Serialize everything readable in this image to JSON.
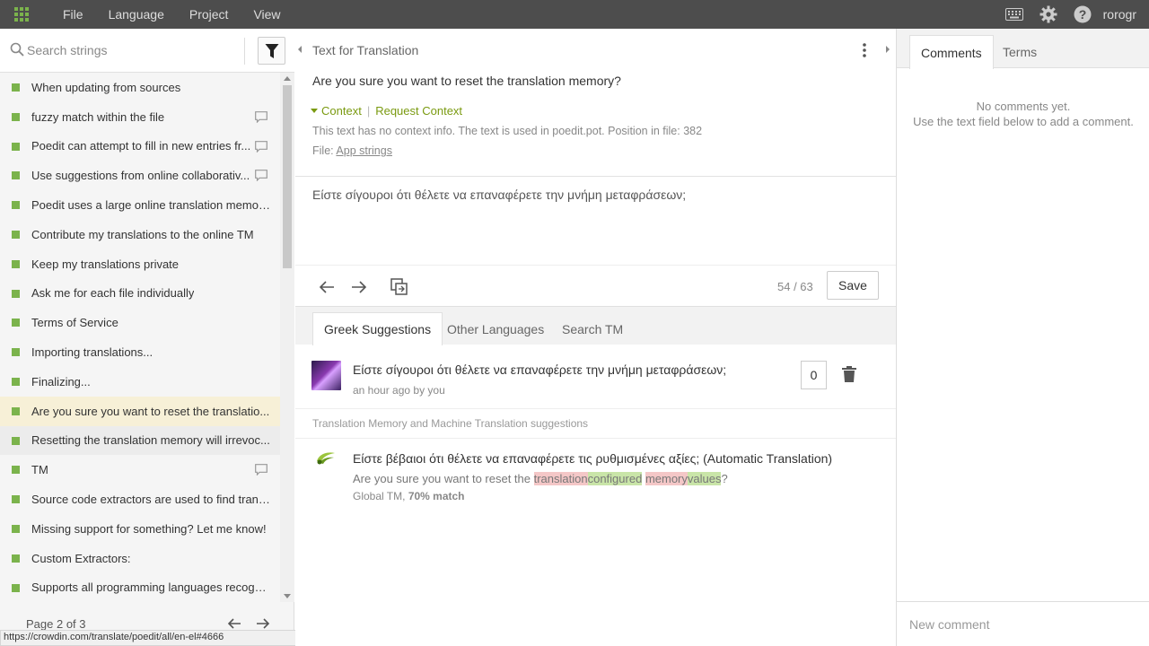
{
  "menu": {
    "items": [
      "File",
      "Language",
      "Project",
      "View"
    ]
  },
  "user": {
    "name": "rorogr"
  },
  "search": {
    "placeholder": "Search strings"
  },
  "strings": [
    {
      "text": "When updating from sources",
      "comment": false,
      "state": ""
    },
    {
      "text": "fuzzy match within the file",
      "comment": true,
      "state": ""
    },
    {
      "text": "Poedit can attempt to fill in new entries fr...",
      "comment": true,
      "state": ""
    },
    {
      "text": "Use suggestions from online collaborativ...",
      "comment": true,
      "state": ""
    },
    {
      "text": "Poedit uses a large online translation memor...",
      "comment": false,
      "state": ""
    },
    {
      "text": "Contribute my translations to the online TM",
      "comment": false,
      "state": ""
    },
    {
      "text": "Keep my translations private",
      "comment": false,
      "state": ""
    },
    {
      "text": "Ask me for each file individually",
      "comment": false,
      "state": ""
    },
    {
      "text": "Terms of Service",
      "comment": false,
      "state": ""
    },
    {
      "text": "Importing translations...",
      "comment": false,
      "state": ""
    },
    {
      "text": "Finalizing...",
      "comment": false,
      "state": ""
    },
    {
      "text": "Are you sure you want to reset the translatio...",
      "comment": false,
      "state": "active"
    },
    {
      "text": "Resetting the translation memory will irrevoc...",
      "comment": false,
      "state": "hover"
    },
    {
      "text": "TM",
      "comment": true,
      "state": ""
    },
    {
      "text": "Source code extractors are used to find trans...",
      "comment": false,
      "state": ""
    },
    {
      "text": "Missing support for something? Let me know!",
      "comment": false,
      "state": ""
    },
    {
      "text": "Custom Extractors:",
      "comment": false,
      "state": ""
    },
    {
      "text": "Supports all programming languages recogni...",
      "comment": false,
      "state": ""
    }
  ],
  "pager": {
    "label": "Page 2 of 3"
  },
  "status_url": "https://crowdin.com/translate/poedit/all/en-el#4666",
  "editor": {
    "header": "Text for Translation",
    "source": "Are you sure you want to reset the translation memory?",
    "context_label": "Context",
    "request_context": "Request Context",
    "context_info": "This text has no context info. The text is used in poedit.pot. Position in file: 382",
    "file_prefix": "File:",
    "file_link": "App strings",
    "translation": "Είστε σίγουροι ότι θέλετε να επαναφέρετε την μνήμη μεταφράσεων;",
    "count": "54 / 63",
    "save_label": "Save"
  },
  "tabs": [
    "Greek Suggestions",
    "Other Languages",
    "Search TM"
  ],
  "suggestion": {
    "text": "Είστε σίγουροι ότι θέλετε να επαναφέρετε την μνήμη μεταφράσεων;",
    "meta": "an hour ago by you",
    "votes": "0"
  },
  "tm": {
    "label": "Translation Memory and Machine Translation suggestions",
    "text": "Είστε βέβαιοι ότι θέλετε να επαναφέρετε τις ρυθμισμένες αξίες; (Automatic Translation)",
    "src_a": "Are you sure you want to reset the ",
    "src_del1": "translation",
    "src_ins1": "configured",
    "src_space": " ",
    "src_del2": "memory",
    "src_ins2": "values",
    "src_end": "?",
    "meta_a": "Global TM, ",
    "meta_b": "70% match"
  },
  "right": {
    "tabs": [
      "Comments",
      "Terms"
    ],
    "no_comments": "No comments yet.",
    "hint": "Use the text field below to add a comment.",
    "new_placeholder": "New comment"
  },
  "colors": {
    "accent": "#7bb34c",
    "link": "#7a9a10",
    "topbar": "#4d4d4d"
  }
}
